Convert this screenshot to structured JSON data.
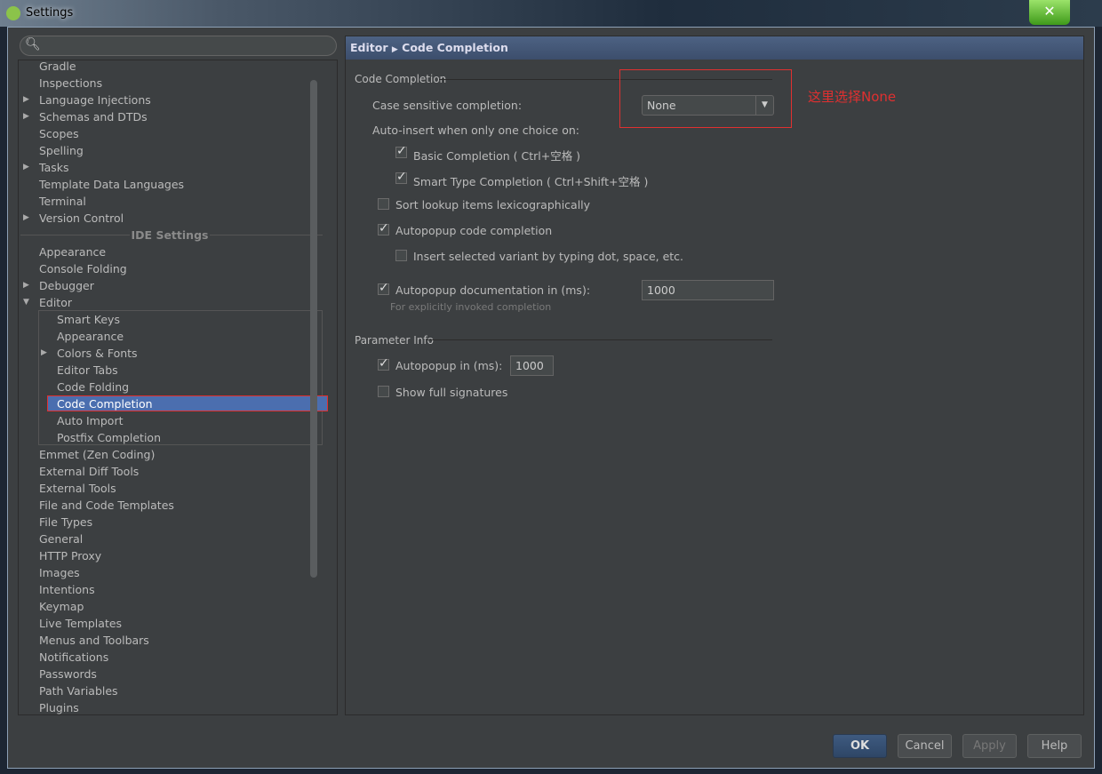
{
  "window": {
    "title": "Settings",
    "close_icon": "close"
  },
  "search": {
    "placeholder": ""
  },
  "tree": {
    "items_top": [
      {
        "label": "Gradle",
        "arrow": false
      },
      {
        "label": "Inspections",
        "arrow": false
      },
      {
        "label": "Language Injections",
        "arrow": true
      },
      {
        "label": "Schemas and DTDs",
        "arrow": true
      },
      {
        "label": "Scopes",
        "arrow": false
      },
      {
        "label": "Spelling",
        "arrow": false
      },
      {
        "label": "Tasks",
        "arrow": true
      },
      {
        "label": "Template Data Languages",
        "arrow": false
      },
      {
        "label": "Terminal",
        "arrow": false
      },
      {
        "label": "Version Control",
        "arrow": true
      }
    ],
    "separator": "IDE Settings",
    "items_ide": [
      {
        "label": "Appearance",
        "arrow": false
      },
      {
        "label": "Console Folding",
        "arrow": false
      },
      {
        "label": "Debugger",
        "arrow": true
      },
      {
        "label": "Editor",
        "arrow": "open"
      }
    ],
    "editor_children": [
      {
        "label": "Smart Keys"
      },
      {
        "label": "Appearance"
      },
      {
        "label": "Colors & Fonts",
        "arrow": true
      },
      {
        "label": "Editor Tabs"
      },
      {
        "label": "Code Folding"
      },
      {
        "label": "Code Completion",
        "selected": true
      },
      {
        "label": "Auto Import"
      },
      {
        "label": "Postfix Completion"
      }
    ],
    "items_bottom": [
      "Emmet (Zen Coding)",
      "External Diff Tools",
      "External Tools",
      "File and Code Templates",
      "File Types",
      "General",
      "HTTP Proxy",
      "Images",
      "Intentions",
      "Keymap",
      "Live Templates",
      "Menus and Toolbars",
      "Notifications",
      "Passwords",
      "Path Variables",
      "Plugins"
    ]
  },
  "header": {
    "crumb1": "Editor",
    "crumb2": "Code Completion"
  },
  "code_completion": {
    "group": "Code Completion",
    "case_label": "Case sensitive completion:",
    "case_value": "None",
    "auto_insert_label": "Auto-insert when only one choice on:",
    "basic": {
      "label": "Basic Completion ( Ctrl+空格 )",
      "checked": true
    },
    "smart": {
      "label": "Smart Type Completion ( Ctrl+Shift+空格 )",
      "checked": true
    },
    "sort": {
      "label": "Sort lookup items lexicographically",
      "checked": false
    },
    "autopopup": {
      "label": "Autopopup code completion",
      "checked": true
    },
    "insert_variant": {
      "label": "Insert selected variant by typing dot, space, etc.",
      "checked": false
    },
    "autopopup_doc": {
      "label": "Autopopup documentation in (ms):",
      "checked": true,
      "value": "1000"
    },
    "hint": "For explicitly invoked completion"
  },
  "parameter_info": {
    "group": "Parameter Info",
    "autopopup": {
      "label": "Autopopup in (ms):",
      "checked": true,
      "value": "1000"
    },
    "full_sig": {
      "label": "Show full signatures",
      "checked": false
    }
  },
  "annotation": {
    "text": "这里选择None",
    "color": "#e03030"
  },
  "buttons": {
    "ok": "OK",
    "cancel": "Cancel",
    "apply": "Apply",
    "help": "Help"
  }
}
